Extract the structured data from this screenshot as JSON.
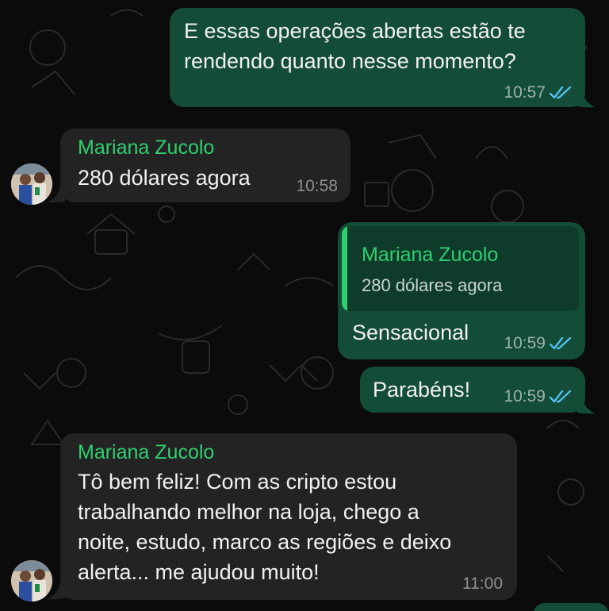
{
  "colors": {
    "background": "#0b0b0b",
    "outgoing_bubble": "#144d37",
    "incoming_bubble": "#232323",
    "sender_name": "#2fcf6f",
    "read_ticks": "#53bdeb"
  },
  "messages": [
    {
      "direction": "outgoing",
      "text_lines": [
        "E essas operações abertas estão te",
        "rendendo quanto nesse momento?"
      ],
      "time": "10:57",
      "status_icon": "double-check-read-icon"
    },
    {
      "direction": "incoming",
      "sender": "Mariana Zucolo",
      "text_lines": [
        "280 dólares agora"
      ],
      "time": "10:58"
    },
    {
      "direction": "outgoing",
      "quote": {
        "sender": "Mariana Zucolo",
        "text": "280 dólares agora"
      },
      "text_lines": [
        "Sensacional"
      ],
      "time": "10:59",
      "status_icon": "double-check-read-icon"
    },
    {
      "direction": "outgoing",
      "text_lines": [
        "Parabéns!"
      ],
      "time": "10:59",
      "status_icon": "double-check-read-icon"
    },
    {
      "direction": "incoming",
      "sender": "Mariana Zucolo",
      "text_lines": [
        "Tô bem feliz! Com as cripto estou",
        "trabalhando melhor na loja, chego a",
        "noite, estudo, marco as regiões e deixo",
        "alerta... me ajudou muito!"
      ],
      "time": "11:00"
    }
  ]
}
